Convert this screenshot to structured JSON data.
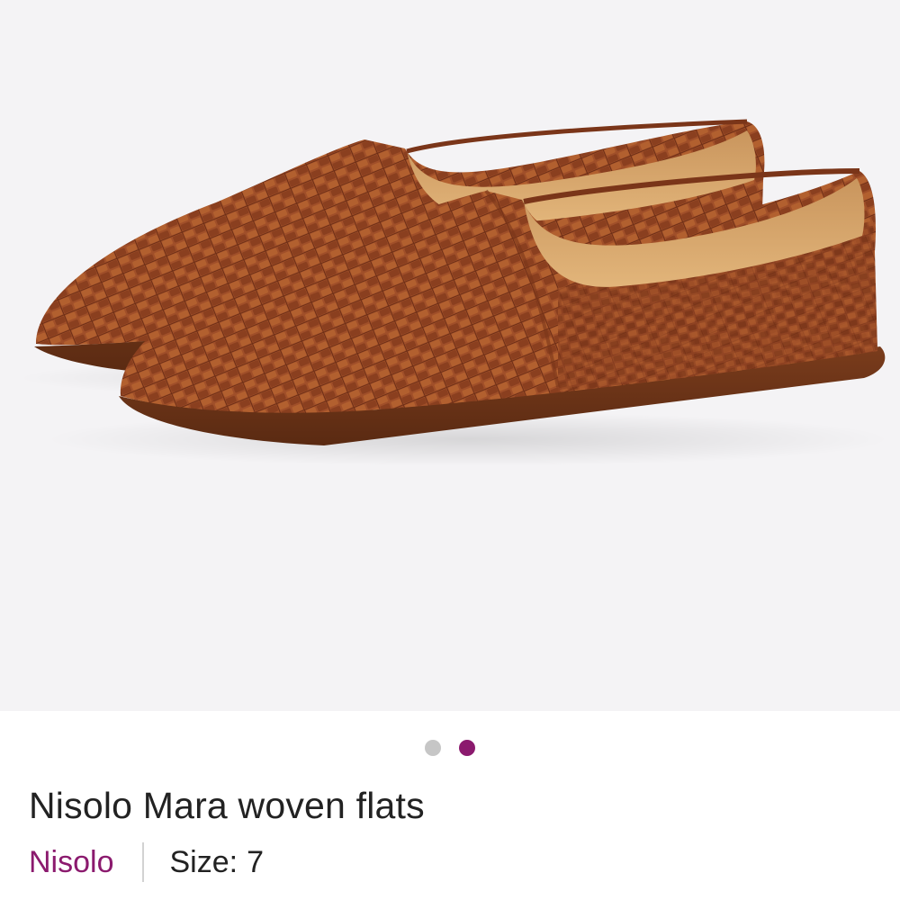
{
  "product": {
    "title": "Nisolo Mara woven flats",
    "brand": "Nisolo",
    "size_label": "Size:",
    "size_value": "7",
    "image_description_icon": "woven-flats-photo"
  },
  "carousel": {
    "total": 2,
    "active_index": 1
  },
  "colors": {
    "accent": "#8b1a6e",
    "inactive_dot": "#c6c6c6",
    "photo_background": "#f4f3f5",
    "leather": "#9c4a26"
  }
}
